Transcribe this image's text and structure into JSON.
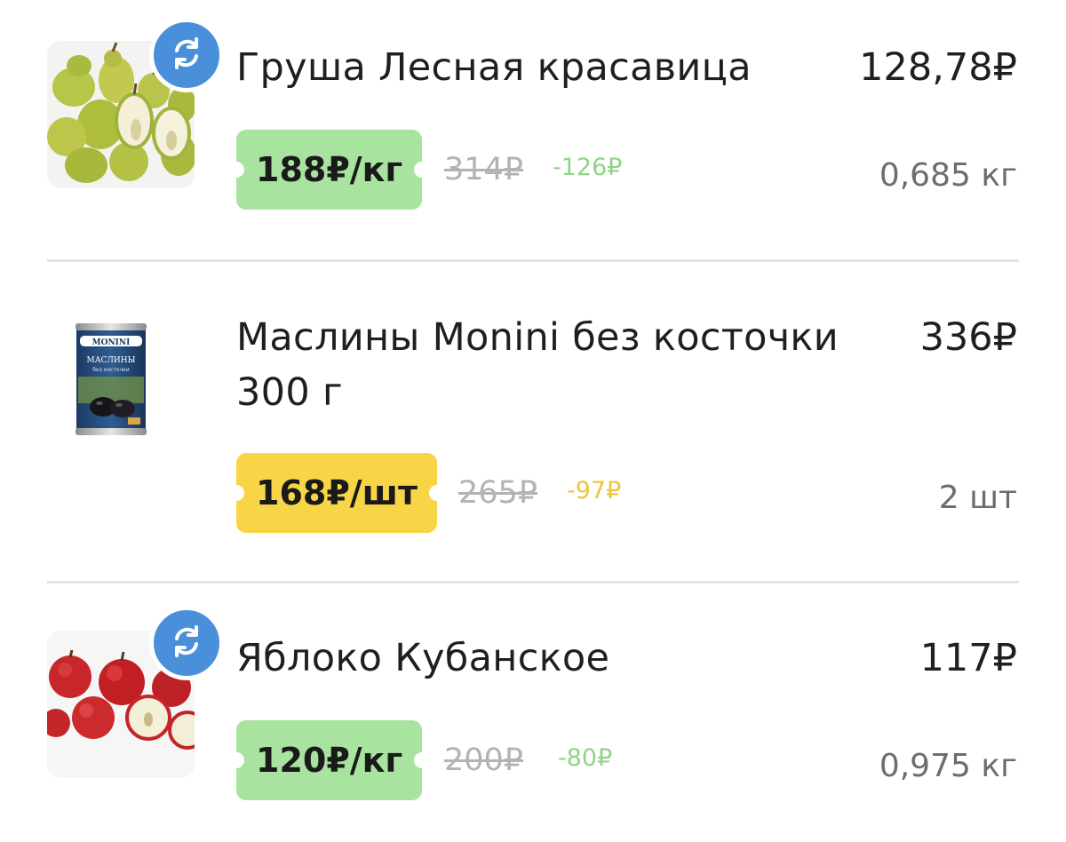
{
  "items": [
    {
      "name": "Груша Лесная красавица",
      "total": "128,78₽",
      "price_tag": "188₽/кг",
      "old_price": "314₽",
      "discount": "-126₽",
      "quantity": "0,685 кг",
      "has_replace_badge": true,
      "tag_color": "#a9e3a0",
      "image": "pears-photo",
      "badge_icon": "swap-arrows-icon"
    },
    {
      "name": "Маслины Monini без косточки 300 г",
      "total": "336₽",
      "price_tag": "168₽/шт",
      "old_price": "265₽",
      "discount": "-97₽",
      "quantity": "2 шт",
      "has_replace_badge": false,
      "tag_color": "#f8d547",
      "image": "olives-can-photo",
      "can_brand": "MONINI",
      "can_label": "МАСЛИНЫ",
      "can_sublabel": "без косточки"
    },
    {
      "name": "Яблоко Кубанское",
      "total": "117₽",
      "price_tag": "120₽/кг",
      "old_price": "200₽",
      "discount": "-80₽",
      "quantity": "0,975 кг",
      "has_replace_badge": true,
      "tag_color": "#a9e3a0",
      "image": "apples-photo",
      "badge_icon": "swap-arrows-icon"
    }
  ],
  "colors": {
    "badge_blue": "#4a8fd9",
    "discount_green": "#8fd486",
    "discount_yellow": "#ebc53a",
    "old_price_gray": "#b3b3b3",
    "qty_gray": "#6d6d6d"
  }
}
